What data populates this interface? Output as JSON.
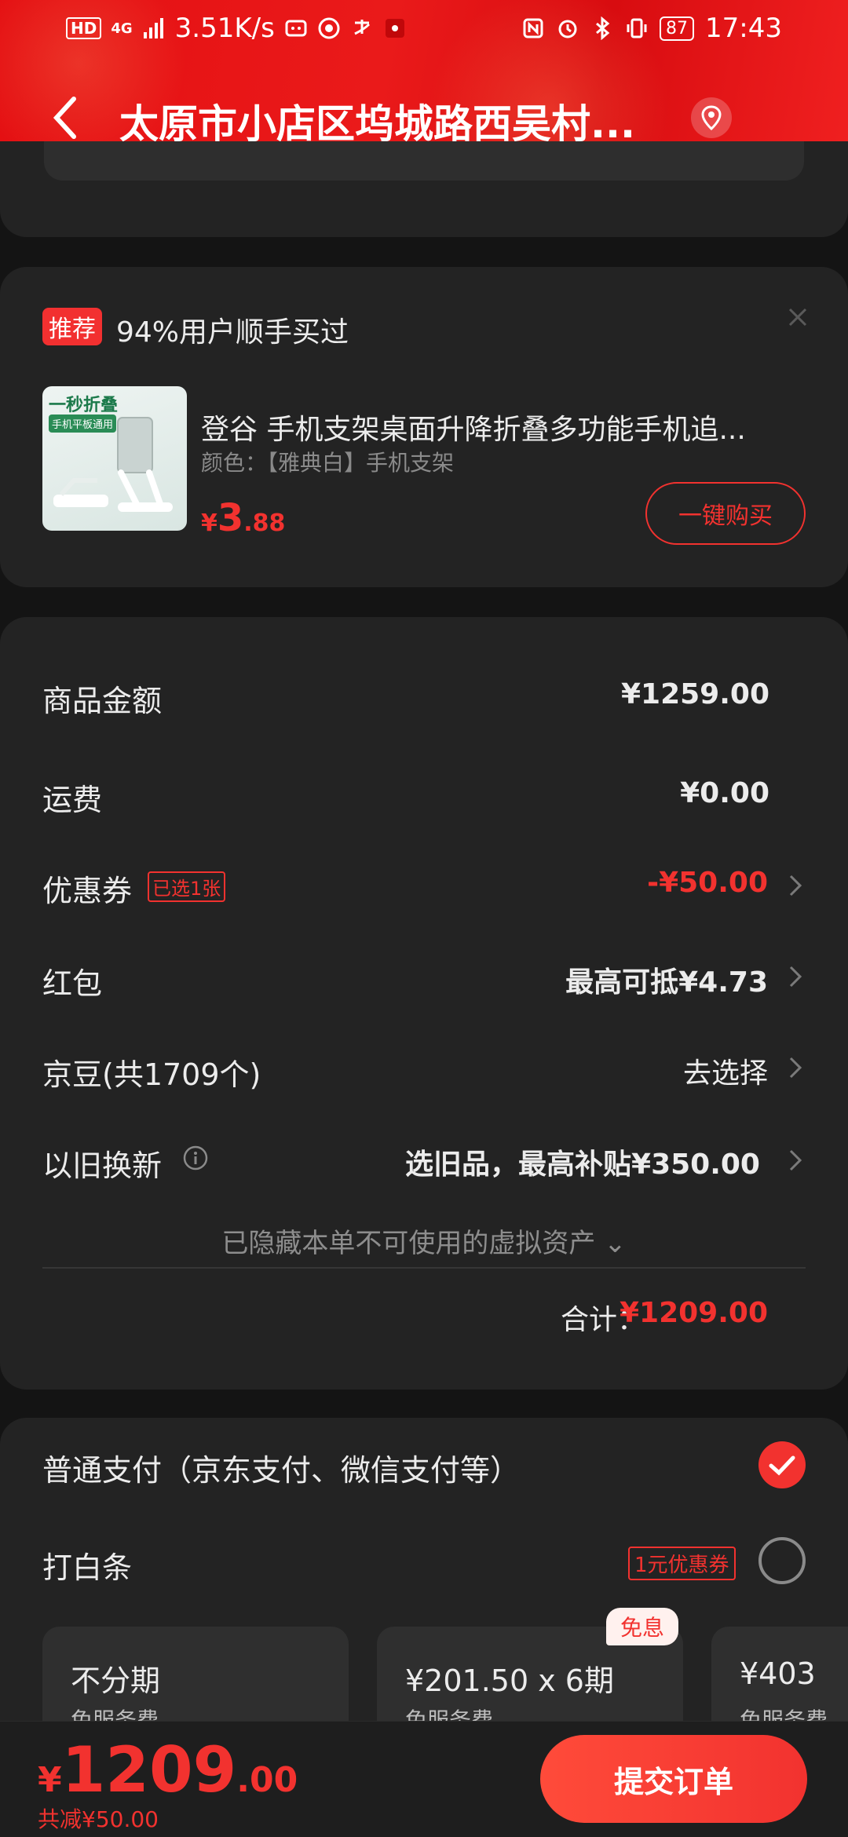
{
  "status_bar": {
    "network_label": "HD",
    "signal_label": "4G",
    "speed": "3.51K/s",
    "battery": "87",
    "time": "17:43"
  },
  "header": {
    "title": "太原市小店区坞城路西吴村...",
    "accent_color": "#e40f12"
  },
  "recommend": {
    "tag": "推荐",
    "title": "94%用户顺手买过",
    "product": {
      "image_caption": "一秒折叠",
      "image_subcaption": "手机平板通用",
      "name": "登谷 手机支架桌面升降折叠多功能手机追...",
      "spec": "颜色：【雅典白】手机支架",
      "price_currency": "¥",
      "price_int": "3",
      "price_dec": ".88",
      "buy_label": "一键购买"
    }
  },
  "cost": {
    "goods_label": "商品金额",
    "goods_value": "¥1259.00",
    "shipping_label": "运费",
    "shipping_value": "¥0.00",
    "coupon_label": "优惠券",
    "coupon_badge": "已选1张",
    "coupon_value": "-¥50.00",
    "redpacket_label": "红包",
    "redpacket_value": "最高可抵¥4.73",
    "beans_label": "京豆(共1709个)",
    "beans_value": "去选择",
    "tradein_label": "以旧换新",
    "tradein_value": "选旧品，最高补贴¥350.00",
    "hidden_note": "已隐藏本单不可使用的虚拟资产 ⌄",
    "total_label": "合计：",
    "total_value": "¥1209.00"
  },
  "payment": {
    "normal_label": "普通支付（京东支付、微信支付等）",
    "baitiao_label": "打白条",
    "baitiao_coupon": "1元优惠券",
    "free_tag": "免息",
    "plans": [
      {
        "title": "不分期",
        "sub": "免服务费"
      },
      {
        "title": "¥201.50 x 6期",
        "sub": "免服务费"
      },
      {
        "title": "¥403",
        "sub": "免服务费"
      }
    ]
  },
  "bottom": {
    "price_currency": "¥",
    "price_int": "1209",
    "price_dec": ".00",
    "saved": "共减¥50.00",
    "submit_label": "提交订单"
  }
}
